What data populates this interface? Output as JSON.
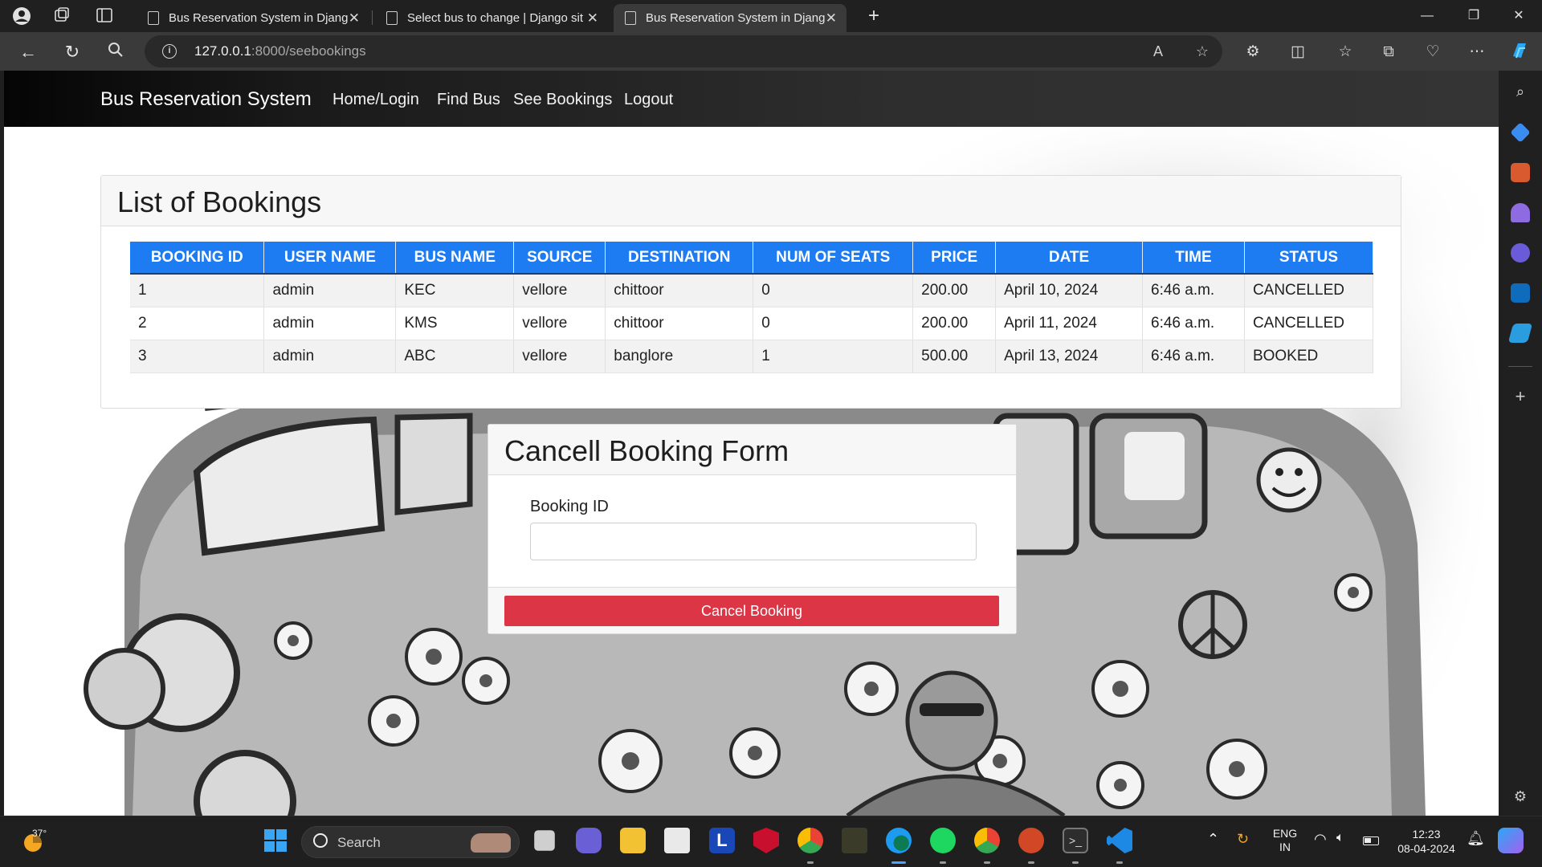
{
  "browser": {
    "tabs": [
      {
        "title": "Bus Reservation System in Djang",
        "active": false
      },
      {
        "title": "Select bus to change | Django sit",
        "active": false
      },
      {
        "title": "Bus Reservation System in Djang",
        "active": true
      }
    ],
    "url_host": "127.0.0.1",
    "url_path": ":8000/seebookings"
  },
  "site": {
    "brand": "Bus Reservation System",
    "nav": [
      "Home/Login",
      "Find Bus",
      "See Bookings",
      "Logout"
    ]
  },
  "bookings": {
    "title": "List of Bookings",
    "columns": [
      "BOOKING ID",
      "USER NAME",
      "BUS NAME",
      "SOURCE",
      "DESTINATION",
      "NUM OF SEATS",
      "PRICE",
      "DATE",
      "TIME",
      "STATUS"
    ],
    "rows": [
      [
        "1",
        "admin",
        "KEC",
        "vellore",
        "chittoor",
        "0",
        "200.00",
        "April 10, 2024",
        "6:46 a.m.",
        "CANCELLED"
      ],
      [
        "2",
        "admin",
        "KMS",
        "vellore",
        "chittoor",
        "0",
        "200.00",
        "April 11, 2024",
        "6:46 a.m.",
        "CANCELLED"
      ],
      [
        "3",
        "admin",
        "ABC",
        "vellore",
        "banglore",
        "1",
        "500.00",
        "April 13, 2024",
        "6:46 a.m.",
        "BOOKED"
      ]
    ],
    "header_color": "#1e7cf2"
  },
  "cancel_form": {
    "title": "Cancell Booking Form",
    "field_label": "Booking ID",
    "field_value": "",
    "button_label": "Cancel Booking",
    "button_color": "#dc3545"
  },
  "taskbar": {
    "weather_temp": "37°",
    "search_placeholder": "Search",
    "lang_top": "ENG",
    "lang_bottom": "IN",
    "time": "12:23",
    "date": "08-04-2024"
  }
}
